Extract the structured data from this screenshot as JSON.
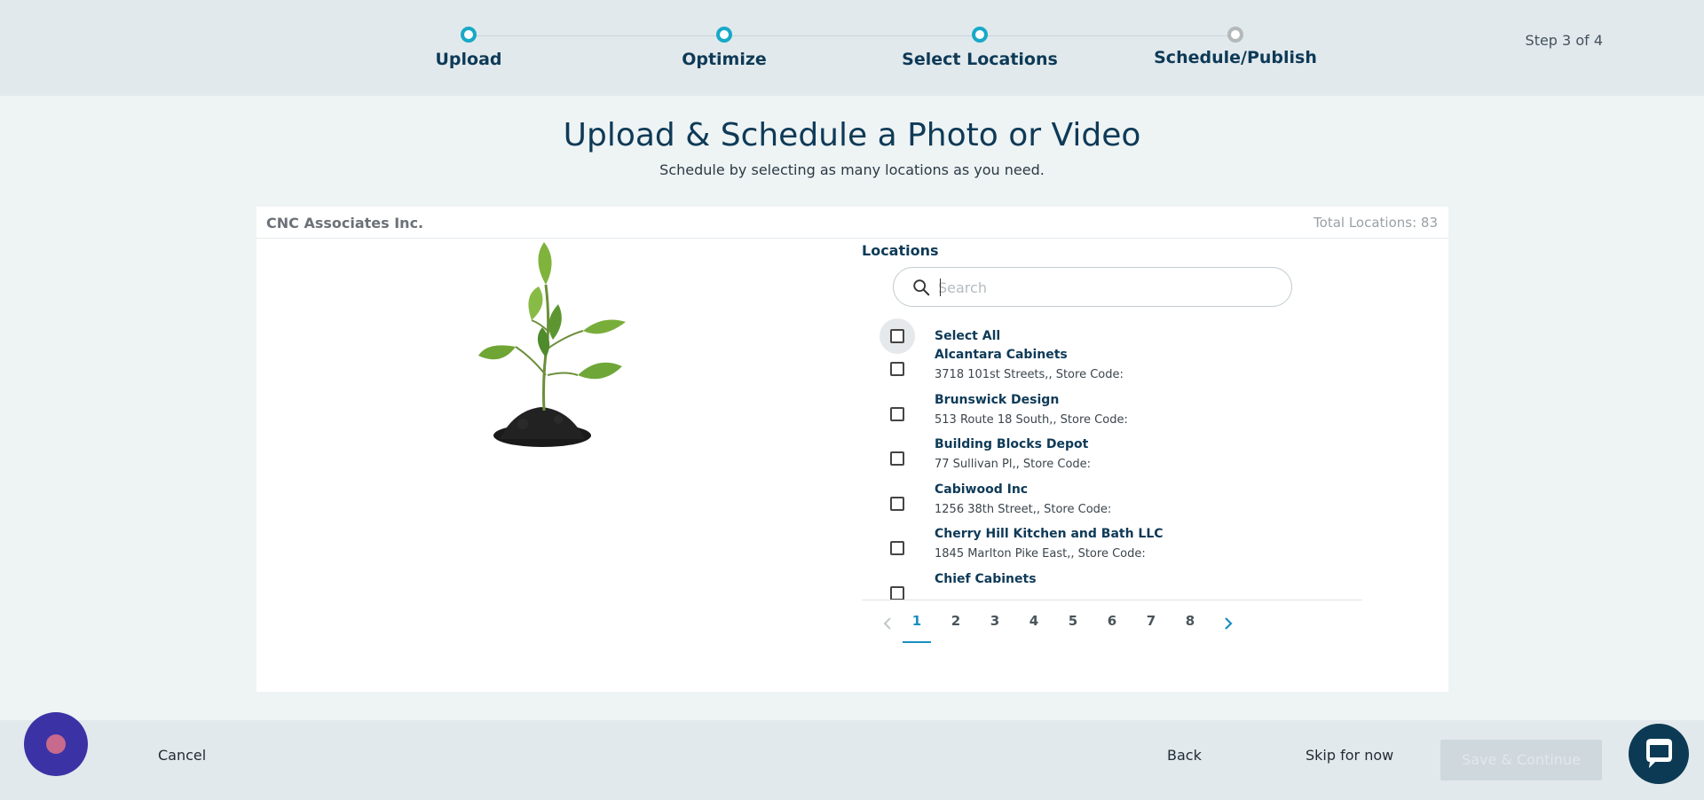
{
  "stepper": {
    "steps": [
      {
        "label": "Upload",
        "status": "complete"
      },
      {
        "label": "Optimize",
        "status": "complete"
      },
      {
        "label": "Select Locations",
        "status": "current"
      },
      {
        "label": "Schedule/Publish",
        "status": "pending"
      }
    ],
    "step_count": "Step 3 of 4"
  },
  "header": {
    "title": "Upload & Schedule a Photo or Video",
    "subtitle": "Schedule by selecting as many locations as you need."
  },
  "card": {
    "company": "CNC Associates Inc.",
    "total_locations": "Total Locations: 83"
  },
  "locations": {
    "title": "Locations",
    "search_placeholder": "Search",
    "select_all_label": "Select All",
    "items": [
      {
        "name": "Alcantara Cabinets",
        "address": "3718 101st Streets,, Store Code:"
      },
      {
        "name": "Brunswick Design",
        "address": "513 Route 18 South,, Store Code:"
      },
      {
        "name": "Building Blocks Depot",
        "address": "77 Sullivan Pl,, Store Code:"
      },
      {
        "name": "Cabiwood Inc",
        "address": "1256 38th Street,, Store Code:"
      },
      {
        "name": "Cherry Hill Kitchen and Bath LLC",
        "address": "1845 Marlton Pike East,, Store Code:"
      },
      {
        "name": "Chief Cabinets",
        "address": ""
      }
    ]
  },
  "pagination": {
    "pages": [
      "1",
      "2",
      "3",
      "4",
      "5",
      "6",
      "7",
      "8"
    ],
    "current": "1"
  },
  "footer": {
    "cancel_label": "Cancel",
    "back_label": "Back",
    "skip_label": "Skip for now",
    "save_label": "Save & Continue"
  },
  "colors": {
    "accent": "#18a9c8",
    "navy": "#0e3a57",
    "pending": "#b3b8bb"
  },
  "icons": {
    "search": "search-icon",
    "chat": "chat-icon",
    "assistant": "assistant-bubble-icon",
    "prev": "chevron-left-icon",
    "next": "chevron-right-icon"
  }
}
